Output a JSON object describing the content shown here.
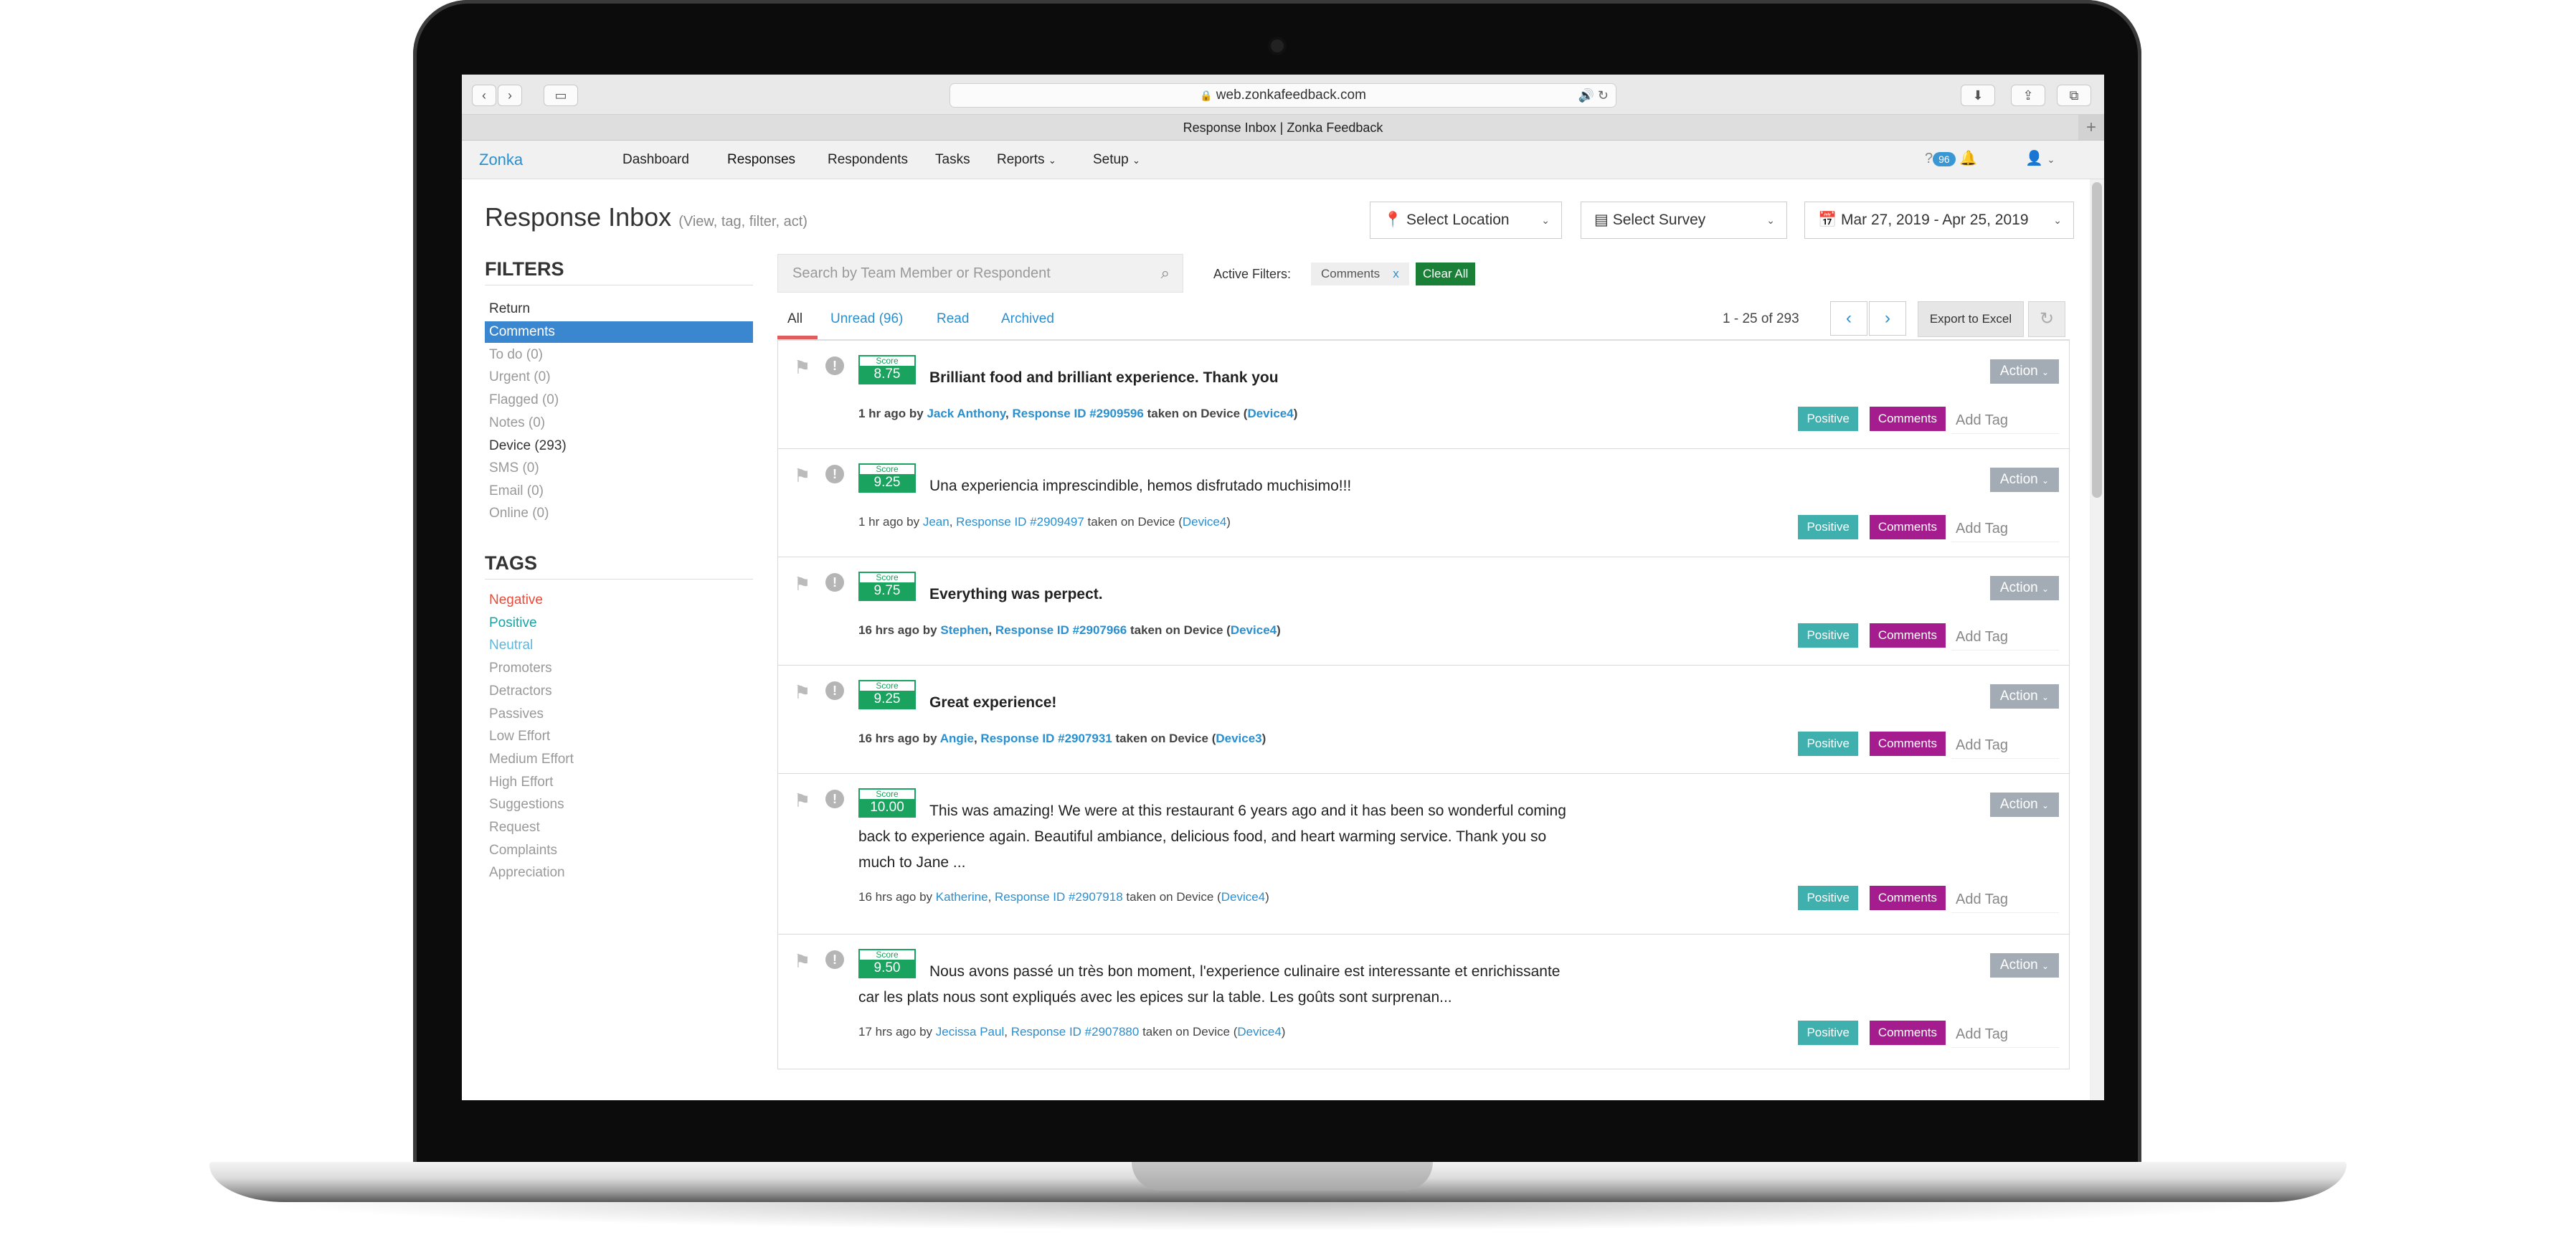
{
  "browser": {
    "url": "web.zonkafeedback.com",
    "tab_title": "Response Inbox | Zonka Feedback"
  },
  "nav": {
    "brand": "Zonka",
    "items": [
      {
        "label": "Dashboard"
      },
      {
        "label": "Responses"
      },
      {
        "label": "Respondents"
      },
      {
        "label": "Tasks"
      },
      {
        "label": "Reports"
      },
      {
        "label": "Setup"
      }
    ],
    "notifications": "96"
  },
  "header": {
    "title": "Response Inbox",
    "subtitle": "(View, tag, filter, act)",
    "location": "Select Location",
    "survey": "Select Survey",
    "date_range": "Mar 27, 2019 - Apr 25, 2019"
  },
  "filters": {
    "heading": "FILTERS",
    "items": [
      {
        "label": "Return"
      },
      {
        "label": "Comments"
      },
      {
        "label": "To do (0)"
      },
      {
        "label": "Urgent (0)"
      },
      {
        "label": "Flagged (0)"
      },
      {
        "label": "Notes (0)"
      },
      {
        "label": "Device (293)"
      },
      {
        "label": "SMS (0)"
      },
      {
        "label": "Email (0)"
      },
      {
        "label": "Online (0)"
      }
    ]
  },
  "tags": {
    "heading": "TAGS",
    "items": [
      {
        "label": "Negative",
        "color": "#e74c3c"
      },
      {
        "label": "Positive",
        "color": "#1aa3a1"
      },
      {
        "label": "Neutral",
        "color": "#5bb8dd"
      },
      {
        "label": "Promoters"
      },
      {
        "label": "Detractors"
      },
      {
        "label": "Passives"
      },
      {
        "label": "Low Effort"
      },
      {
        "label": "Medium Effort"
      },
      {
        "label": "High Effort"
      },
      {
        "label": "Suggestions"
      },
      {
        "label": "Request"
      },
      {
        "label": "Complaints"
      },
      {
        "label": "Appreciation"
      }
    ]
  },
  "inbox": {
    "search_placeholder": "Search by Team Member or Respondent",
    "active_filters_label": "Active Filters:",
    "active_filter": "Comments",
    "clear_all": "Clear All",
    "tabs": [
      {
        "label": "All"
      },
      {
        "label": "Unread (96)"
      },
      {
        "label": "Read"
      },
      {
        "label": "Archived"
      }
    ],
    "pager": "1 - 25 of 293",
    "export": "Export to Excel"
  },
  "labels": {
    "score": "Score",
    "action": "Action",
    "positive": "Positive",
    "comments": "Comments",
    "add_tag": "Add Tag",
    "by": "by",
    "taken_on": "taken on Device",
    "comma": ",",
    "paren_open": "(",
    "paren_close": ")"
  },
  "responses": [
    {
      "score": "8.75",
      "text": "Brilliant food and brilliant experience. Thank you",
      "time": "1 hr ago",
      "name": "Jack Anthony",
      "rid": "Response ID #2909596",
      "device": "Device4"
    },
    {
      "score": "9.25",
      "text": "Una experiencia imprescindible, hemos disfrutado muchisimo!!!",
      "time": "1 hr ago",
      "name": "Jean",
      "rid": "Response ID #2909497",
      "device": "Device4"
    },
    {
      "score": "9.75",
      "text": "Everything was perpect.",
      "time": "16 hrs ago",
      "name": "Stephen",
      "rid": "Response ID #2907966",
      "device": "Device4"
    },
    {
      "score": "9.25",
      "text": "Great experience!",
      "time": "16 hrs ago",
      "name": "Angie",
      "rid": "Response ID #2907931",
      "device": "Device3"
    },
    {
      "score": "10.00",
      "text_lines": [
        "This was amazing! We were at this restaurant 6 years ago and it has been so wonderful coming",
        "back to experience again. Beautiful ambiance, delicious food, and heart warming service. Thank you so",
        "much to Jane ..."
      ],
      "time": "16 hrs ago",
      "name": "Katherine",
      "rid": "Response ID #2907918",
      "device": "Device4"
    },
    {
      "score": "9.50",
      "text_lines": [
        "Nous avons passé un très bon moment, l'experience culinaire est interessante et enrichissante",
        "car les plats nous sont expliqués avec les epices sur la table. Les goûts sont surprenan..."
      ],
      "time": "17 hrs ago",
      "name": "Jecissa Paul",
      "rid": "Response ID #2907880",
      "device": "Device4"
    }
  ]
}
